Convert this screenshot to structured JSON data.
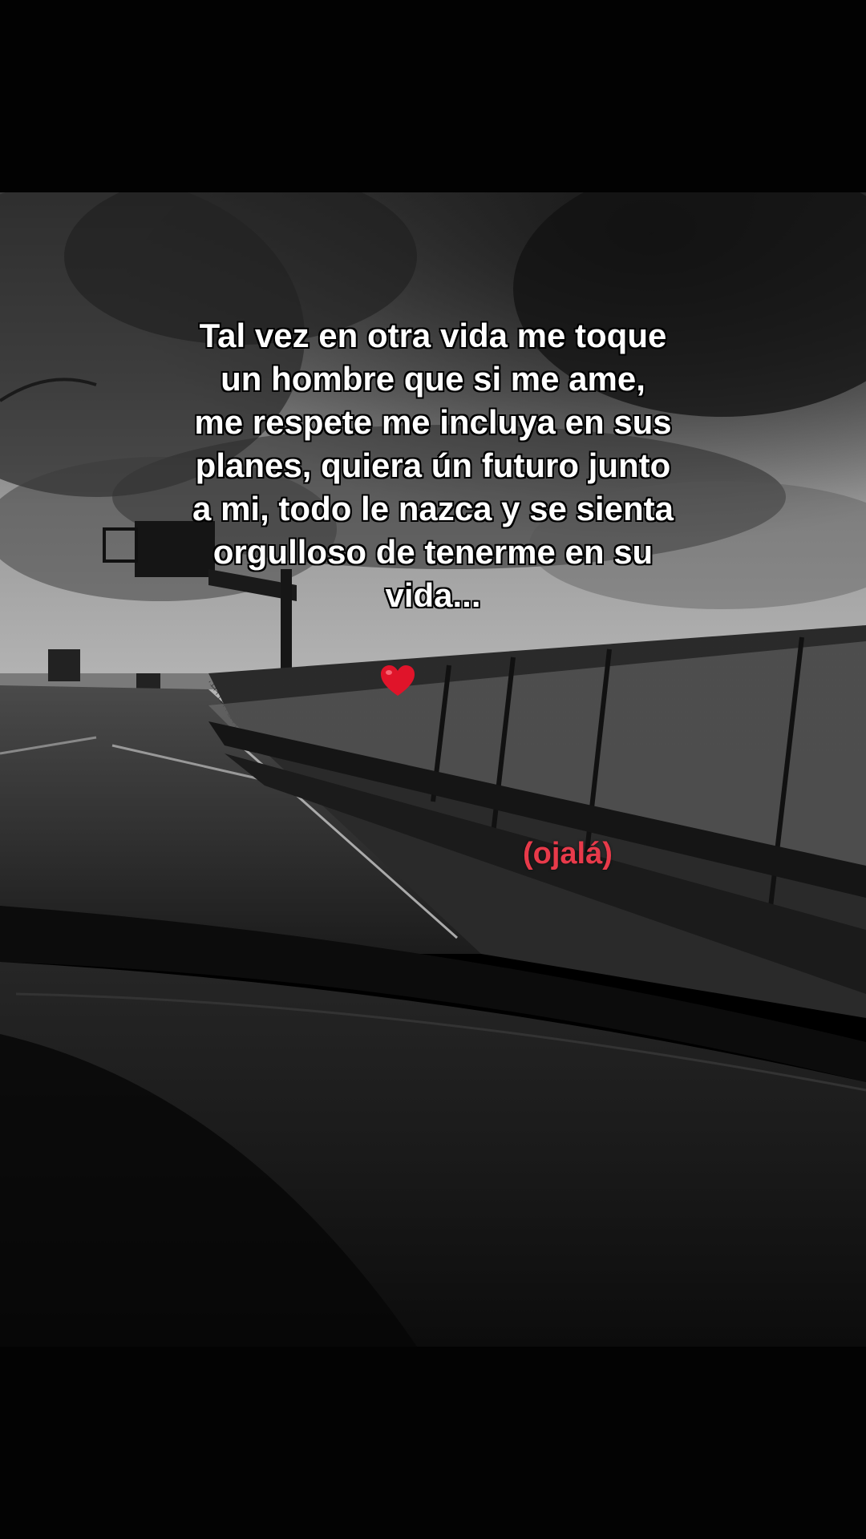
{
  "caption": {
    "text": "Tal vez en otra vida me toque\nun hombre que si me ame,\nme respete me incluya en sus\nplanes, quiera ún futuro junto\na mi, todo le nazca y se sienta\norgulloso de tenerme en su\nvida..."
  },
  "heart": {
    "icon": "red-heart-icon",
    "color": "#e0142a"
  },
  "annotation": {
    "text": "(ojalá)",
    "color": "#e83a4a"
  }
}
